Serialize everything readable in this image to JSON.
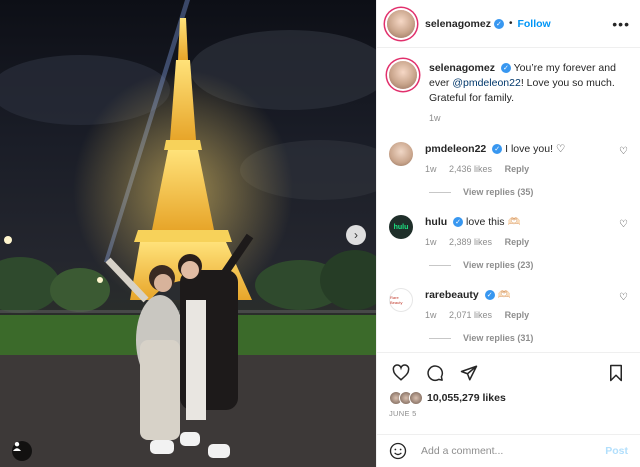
{
  "post": {
    "author": "selenagomez",
    "follow_label": "Follow",
    "dot": "•",
    "more_label": "•••"
  },
  "caption": {
    "username": "selenagomez",
    "text_before": "You’re my forever and ever ",
    "mention": "@pmdeleon22",
    "text_after": "! Love you so much. Grateful for family.",
    "time": "1w"
  },
  "comments": [
    {
      "username": "pmdeleon22",
      "text": "I love you! ♡",
      "time": "1w",
      "likes": "2,436 likes",
      "reply": "Reply",
      "view_replies": "View replies (35)"
    },
    {
      "username": "hulu",
      "text": "love this 🫶🏻",
      "time": "1w",
      "likes": "2,389 likes",
      "reply": "Reply",
      "view_replies": "View replies (23)",
      "logo_text": "hulu"
    },
    {
      "username": "rarebeauty",
      "text": "🫶🏻",
      "time": "1w",
      "likes": "2,071 likes",
      "reply": "Reply",
      "view_replies": "View replies (31)",
      "logo_text": "Rare Beauty"
    }
  ],
  "actions": {
    "icons": [
      "heart-icon",
      "comment-icon",
      "share-icon",
      "bookmark-icon"
    ],
    "likes": "10,055,279 likes",
    "date": "June 5"
  },
  "add_comment": {
    "placeholder": "Add a comment...",
    "post_label": "Post"
  },
  "photo": {
    "next_symbol": "›"
  },
  "colors": {
    "accent": "#0095f6",
    "verified": "#3897f0",
    "tower_glow": "#f5c542"
  }
}
